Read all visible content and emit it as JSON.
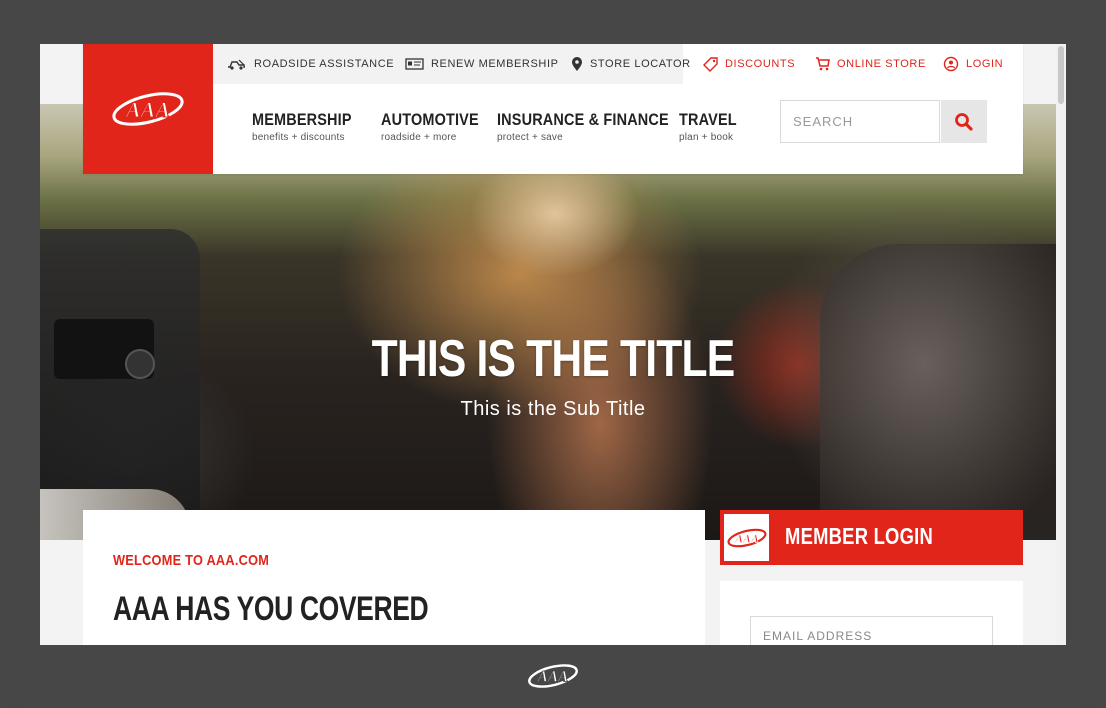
{
  "brand": {
    "logo_text": "AAA",
    "accent_color": "#e1251b"
  },
  "utility_nav": [
    {
      "label": "ROADSIDE ASSISTANCE",
      "icon": "tow-truck-icon"
    },
    {
      "label": "RENEW MEMBERSHIP",
      "icon": "membership-card-icon"
    },
    {
      "label": "STORE LOCATOR",
      "icon": "map-pin-icon"
    },
    {
      "label": "DISCOUNTS",
      "icon": "tag-icon"
    },
    {
      "label": "ONLINE STORE",
      "icon": "cart-icon"
    },
    {
      "label": "LOGIN",
      "icon": "user-icon"
    }
  ],
  "main_nav": [
    {
      "title": "MEMBERSHIP",
      "sub": "benefits + discounts"
    },
    {
      "title": "AUTOMOTIVE",
      "sub": "roadside + more"
    },
    {
      "title": "INSURANCE & FINANCE",
      "sub": "protect + save"
    },
    {
      "title": "TRAVEL",
      "sub": "plan + book"
    }
  ],
  "search": {
    "placeholder": "SEARCH",
    "icon": "search-icon"
  },
  "hero": {
    "title": "THIS IS THE TITLE",
    "subtitle": "This is the Sub Title"
  },
  "welcome": {
    "kicker": "WELCOME TO AAA.COM",
    "heading": "AAA HAS YOU COVERED"
  },
  "member_login": {
    "title": "MEMBER LOGIN",
    "email_placeholder": "EMAIL ADDRESS"
  }
}
